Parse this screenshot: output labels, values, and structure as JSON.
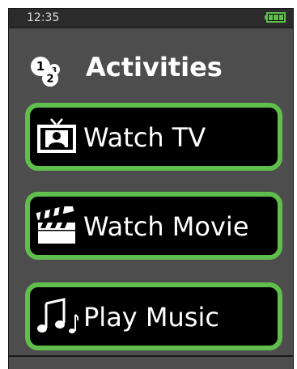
{
  "status_bar": {
    "time": "12:35",
    "battery_icon": "battery-full-icon",
    "battery_color": "#5fbe4c"
  },
  "header": {
    "title": "Activities",
    "icon": "numbered-circles-icon"
  },
  "activities": [
    {
      "label": "Watch TV",
      "icon": "television-icon"
    },
    {
      "label": "Watch Movie",
      "icon": "clapperboard-icon"
    },
    {
      "label": "Play Music",
      "icon": "music-notes-icon"
    }
  ],
  "colors": {
    "accent": "#5fbe4c",
    "background": "#4d4d4d",
    "button_fill": "#000000"
  }
}
